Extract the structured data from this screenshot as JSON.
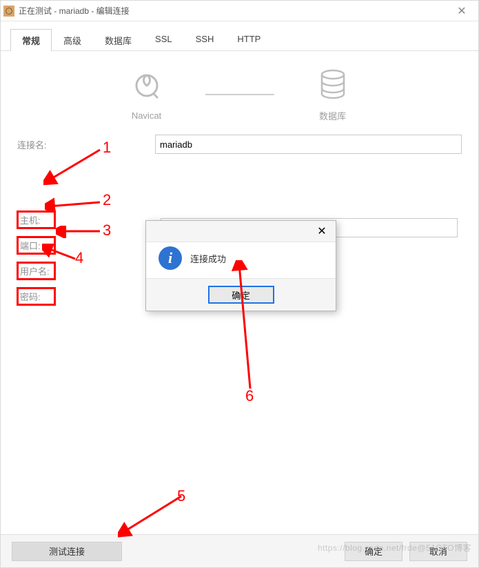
{
  "window": {
    "title": "正在测试 - mariadb - 编辑连接"
  },
  "tabs": [
    {
      "label": "常规",
      "active": true
    },
    {
      "label": "高级",
      "active": false
    },
    {
      "label": "数据库",
      "active": false
    },
    {
      "label": "SSL",
      "active": false
    },
    {
      "label": "SSH",
      "active": false
    },
    {
      "label": "HTTP",
      "active": false
    }
  ],
  "icons": {
    "left_label": "Navicat",
    "right_label": "数据库"
  },
  "form": {
    "conn_name_label": "连接名:",
    "conn_name_value": "mariadb",
    "host_label": "主机:",
    "port_label": "端口:",
    "user_label": "用户名:",
    "password_label": "密码:"
  },
  "footer": {
    "test_label": "测试连接",
    "ok_label": "确定",
    "cancel_label": "取消"
  },
  "modal": {
    "message": "连接成功",
    "ok_label": "确定"
  },
  "annotations": {
    "n1": "1",
    "n2": "2",
    "n3": "3",
    "n4": "4",
    "n5": "5",
    "n6": "6"
  },
  "watermark": "https://blog.csdn.net/frde@51CTO博客"
}
